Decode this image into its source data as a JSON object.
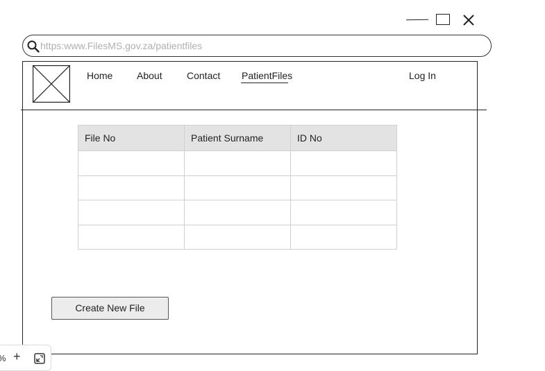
{
  "window": {
    "minimize_icon": "minimize-icon",
    "maximize_icon": "maximize-icon",
    "close_icon": "close-icon"
  },
  "address_bar": {
    "icon": "search-icon",
    "url": "https:www.FilesMS.gov.za/patientfiles"
  },
  "site": {
    "logo": "image-placeholder-icon",
    "nav": [
      {
        "label": "Home"
      },
      {
        "label": "About"
      },
      {
        "label": "Contact"
      },
      {
        "label": "PatientFiles",
        "active": true
      },
      {
        "label": "Log In"
      }
    ]
  },
  "files_table": {
    "columns": [
      "File No",
      "Patient Surname",
      "ID No"
    ],
    "rows": [
      [
        "",
        "",
        ""
      ],
      [
        "",
        "",
        ""
      ],
      [
        "",
        "",
        ""
      ],
      [
        "",
        "",
        ""
      ]
    ]
  },
  "actions": {
    "create_new_file": "Create New File"
  },
  "zoom_toolbar": {
    "percent_suffix": "%",
    "zoom_in": "+",
    "fit_icon": "fit-to-screen-icon"
  },
  "colors": {
    "stroke": "#222222",
    "table_header_bg": "#e3e3e3",
    "table_border": "#cfcfcf",
    "button_bg": "#ececec",
    "url_text": "#b0b0b0"
  }
}
